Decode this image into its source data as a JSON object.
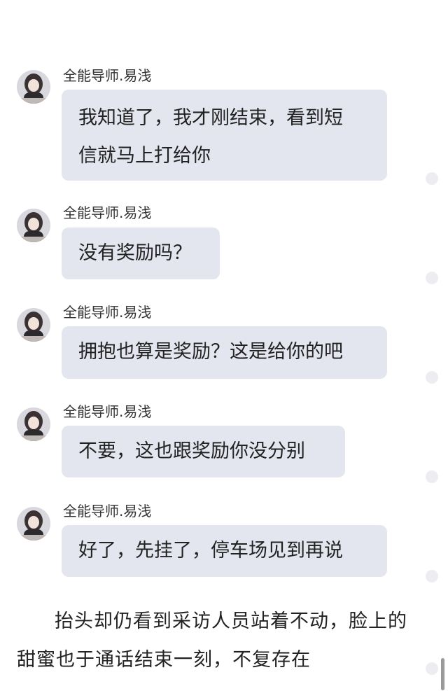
{
  "messages": [
    {
      "sender": "全能导师.易浅",
      "lines": [
        "我知道了，我才刚结束，看到短",
        "信就马上打给你"
      ]
    },
    {
      "sender": "全能导师.易浅",
      "lines": [
        "没有奖励吗？"
      ]
    },
    {
      "sender": "全能导师.易浅",
      "lines": [
        "拥抱也算是奖励？这是给你的吧"
      ]
    },
    {
      "sender": "全能导师.易浅",
      "lines": [
        "不要，这也跟奖励你没分别"
      ]
    },
    {
      "sender": "全能导师.易浅",
      "lines": [
        "好了，先挂了，停车场见到再说"
      ]
    }
  ],
  "narration": {
    "text": "抬头却仍看到采访人员站着不动，脸上的甜蜜也于通话结束一刻，不复存在"
  },
  "icons": {
    "avatar": "avatar-icon",
    "side_dot": "dot-icon"
  }
}
